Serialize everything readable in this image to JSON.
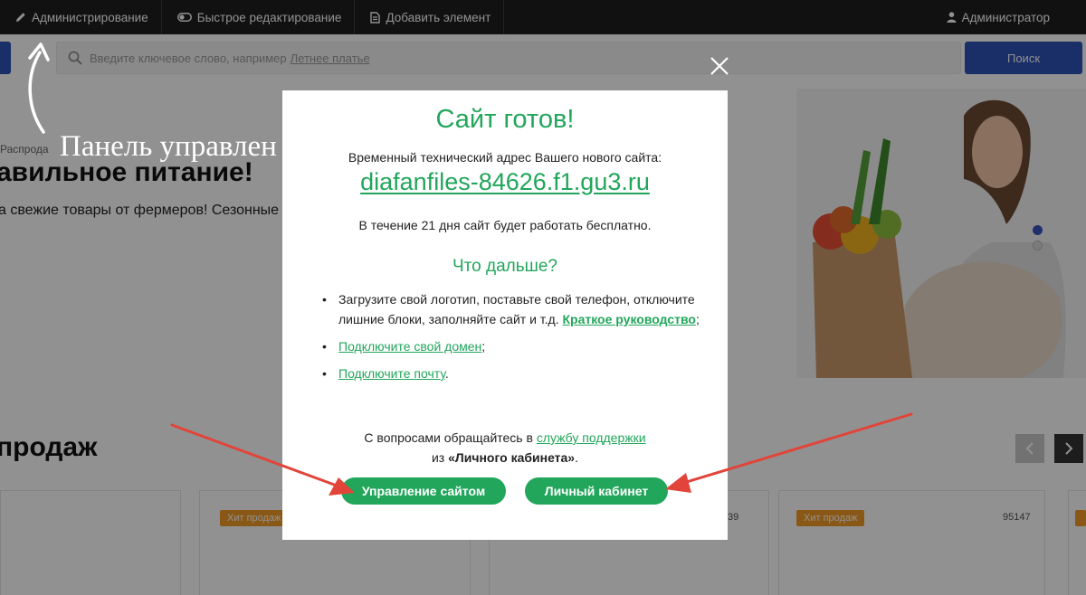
{
  "topbar": {
    "admin": "Администрирование",
    "quick_edit": "Быстрое редактирование",
    "add_element": "Добавить элемент",
    "user": "Администратор"
  },
  "search": {
    "placeholder": "Введите ключевое слово, например",
    "example": "Летнее платье",
    "button": "Поиск"
  },
  "page": {
    "breadcrumb": "Распрода",
    "hero_title": "авильное питание!",
    "hero_subtitle": "а свежие товары от фермеров! Сезонные",
    "section_title": "продаж",
    "cards": [
      {
        "badge": "Хит продаж",
        "code": "39"
      },
      {
        "badge": "Хит продаж",
        "code": "95147"
      }
    ]
  },
  "annotation": {
    "panel_text": "Панель управлен"
  },
  "modal": {
    "title": "Сайт готов!",
    "temp_address_text": "Временный технический адрес Вашего нового сайта:",
    "url": "diafanfiles-84626.f1.gu3.ru",
    "free_text": "В течение 21 дня сайт будет работать бесплатно.",
    "next_title": "Что дальше?",
    "list": {
      "item1_text": "Загрузите свой логотип, поставьте свой телефон, отключите лишние блоки, заполняйте сайт и т.д.",
      "item1_link": "Краткое руководство",
      "item1_end": ";",
      "item2_link": "Подключите свой домен",
      "item2_end": ";",
      "item3_link": "Подключите почту",
      "item3_end": "."
    },
    "contact": {
      "text_before": "С вопросами обращайтесь в",
      "support_link": "службу поддержки",
      "text_from": "из",
      "cabinet": "«Личного кабинета»",
      "end": "."
    },
    "buttons": {
      "manage": "Управление сайтом",
      "cabinet": "Личный кабинет"
    }
  },
  "colors": {
    "accent_green": "#21a65b",
    "arrow_red": "#e2443a",
    "primary_blue": "#2f52b6"
  }
}
